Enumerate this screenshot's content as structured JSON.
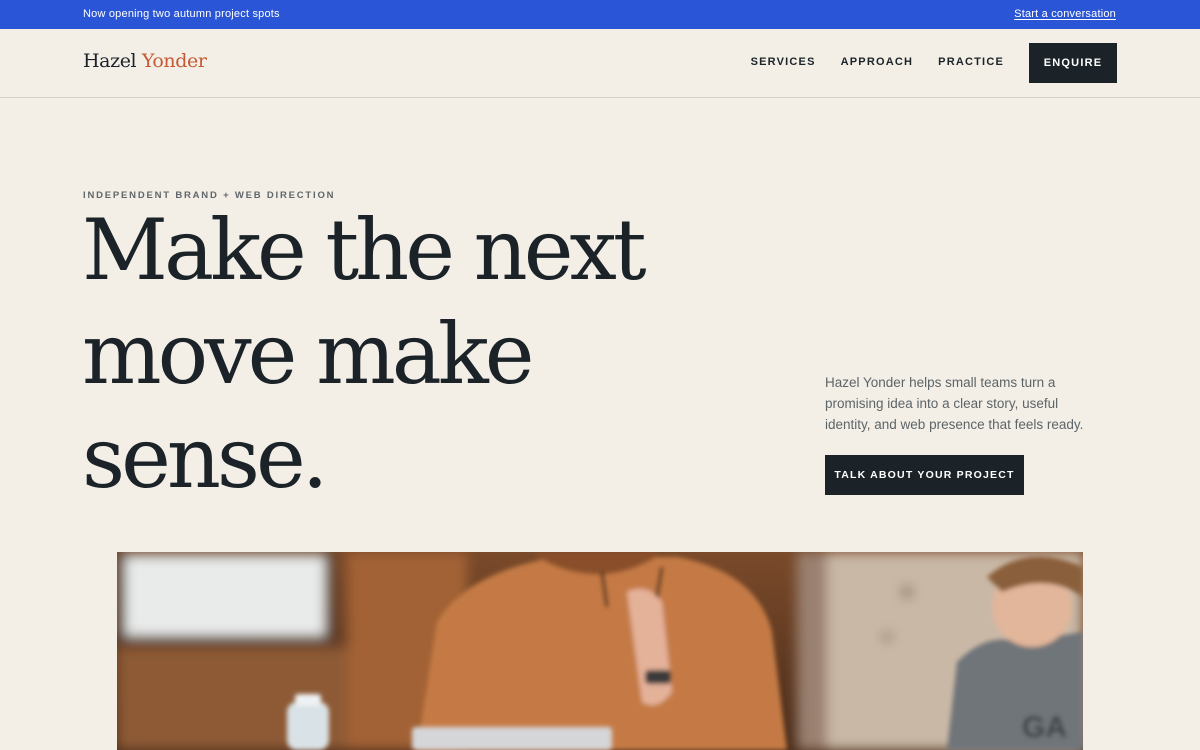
{
  "announcement": {
    "text": "Now opening two autumn project spots",
    "link_label": "Start a conversation"
  },
  "header": {
    "brand_first": "Hazel",
    "brand_second": "Yonder",
    "nav": [
      {
        "label": "SERVICES"
      },
      {
        "label": "APPROACH"
      },
      {
        "label": "PRACTICE"
      }
    ],
    "enquire_label": "ENQUIRE"
  },
  "hero": {
    "eyebrow": "INDEPENDENT BRAND + WEB DIRECTION",
    "headline": "Make the next move make sense.",
    "intro": "Hazel Yonder helps small teams turn a promising idea into a clear story, useful identity, and web presence that feels ready.",
    "cta_label": "TALK ABOUT YOUR PROJECT"
  },
  "colors": {
    "announcement_bg": "#2a55d6",
    "page_bg": "#f3efe7",
    "ink": "#1b2328",
    "brand_accent": "#c35a35"
  }
}
